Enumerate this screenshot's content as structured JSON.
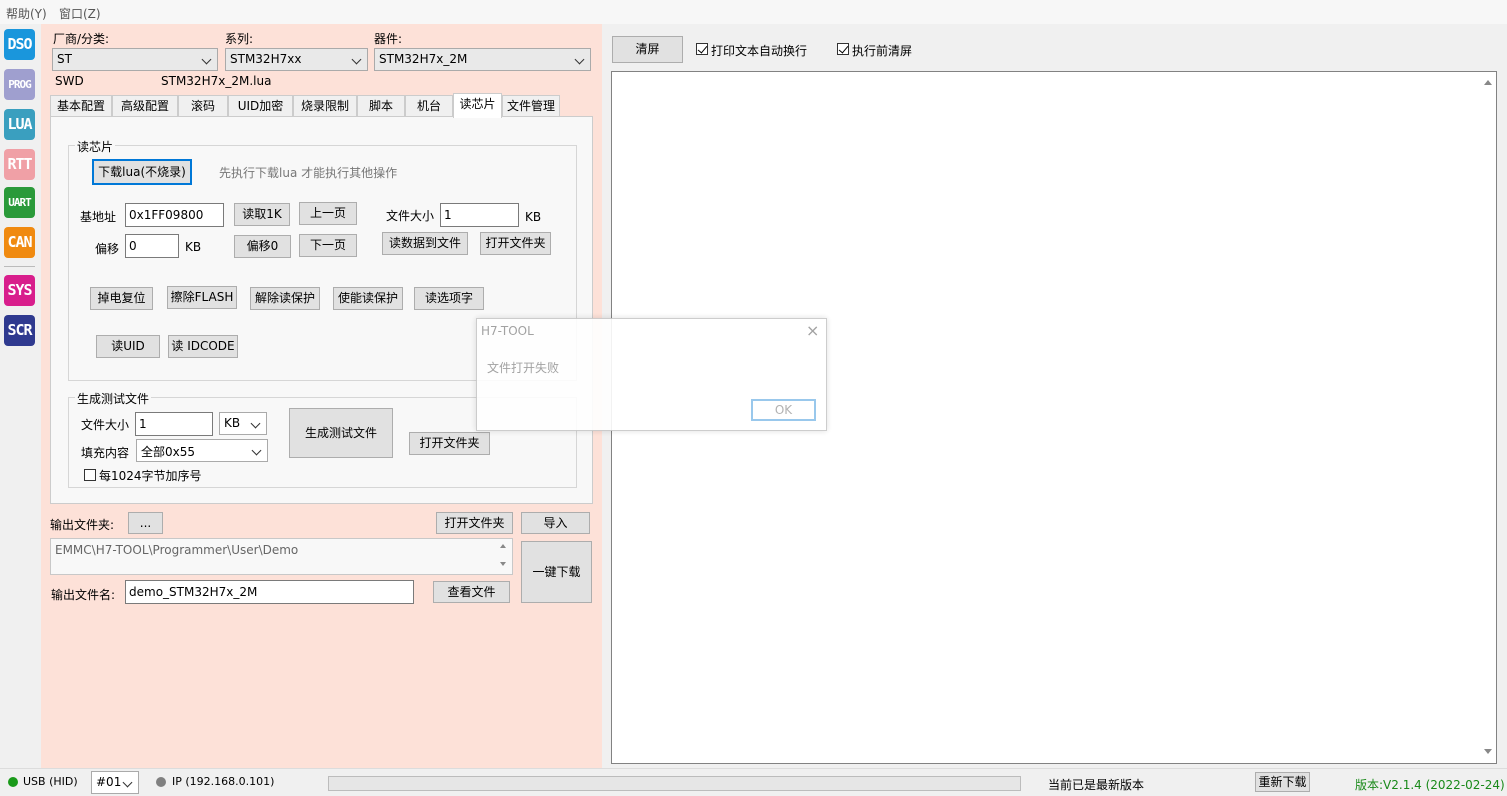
{
  "menu": {
    "help": "帮助(Y)",
    "window": "窗口(Z)"
  },
  "sidebar": {
    "items": [
      {
        "label": "DSO",
        "color": "#1a96dc"
      },
      {
        "label": "PROG",
        "color": "#9f9fcf"
      },
      {
        "label": "LUA",
        "color": "#3a9fbf"
      },
      {
        "label": "RTT",
        "color": "#f0a0a6"
      },
      {
        "label": "UART",
        "color": "#2a9a3a"
      },
      {
        "label": "CAN",
        "color": "#f08a10"
      },
      {
        "label": "SYS",
        "color": "#d81e8c"
      },
      {
        "label": "SCR",
        "color": "#2f3a8f"
      }
    ]
  },
  "device": {
    "vendor_label": "厂商/分类:",
    "vendor_value": "ST",
    "series_label": "系列:",
    "series_value": "STM32H7xx",
    "chip_label": "器件:",
    "chip_value": "STM32H7x_2M",
    "interface": "SWD",
    "lua_file": "STM32H7x_2M.lua"
  },
  "tabs": [
    {
      "label": "基本配置"
    },
    {
      "label": "高级配置"
    },
    {
      "label": "滚码"
    },
    {
      "label": "UID加密"
    },
    {
      "label": "烧录限制"
    },
    {
      "label": "脚本"
    },
    {
      "label": "机台"
    },
    {
      "label": "读芯片"
    },
    {
      "label": "文件管理"
    }
  ],
  "read_chip": {
    "group_title": "读芯片",
    "download_lua_button": "下载lua(不烧录)",
    "hint": "先执行下载lua 才能执行其他操作",
    "base_addr_label": "基地址",
    "base_addr_value": "0x1FF09800",
    "read1k_button": "读取1K",
    "prev_page_button": "上一页",
    "file_size_label": "文件大小",
    "file_size_value": "1",
    "kb_unit": "KB",
    "offset_label": "偏移",
    "offset_value": "0",
    "offset_unit": "KB",
    "offset0_button": "偏移0",
    "next_page_button": "下一页",
    "read_to_file_button": "读数据到文件",
    "open_folder_button": "打开文件夹",
    "power_reset_button": "掉电复位",
    "erase_flash_button": "擦除FLASH",
    "unprotect_button": "解除读保护",
    "protect_button": "使能读保护",
    "read_option_button": "读选项字",
    "read_uid_button": "读UID",
    "read_idcode_button": "读 IDCODE"
  },
  "gen_test": {
    "group_title": "生成测试文件",
    "file_size_label": "文件大小",
    "file_size_value": "1",
    "unit_value": "KB",
    "fill_label": "填充内容",
    "fill_value": "全部0x55",
    "seq_checkbox_label": "每1024字节加序号",
    "generate_button": "生成测试文件",
    "open_folder_button": "打开文件夹"
  },
  "output": {
    "folder_label": "输出文件夹:",
    "browse_button": "...",
    "open_folder_button": "打开文件夹",
    "import_button": "导入",
    "path_value": "EMMC\\H7-TOOL\\Programmer\\User\\Demo",
    "one_click_button": "一键下载",
    "filename_label": "输出文件名:",
    "filename_value": "demo_STM32H7x_2M",
    "view_file_button": "查看文件"
  },
  "log": {
    "clear_button": "清屏",
    "wrap_label": "打印文本自动换行",
    "clear_before_label": "执行前清屏"
  },
  "dialog": {
    "title": "H7-TOOL",
    "message": "文件打开失败",
    "ok_button": "OK"
  },
  "status": {
    "usb_label": "USB (HID)",
    "device_no": "#01",
    "ip_label": "IP (192.168.0.101)",
    "version_status": "当前已是最新版本",
    "redownload_button": "重新下载",
    "version": "版本:V2.1.4 (2022-02-24)",
    "usb_color": "#1a9a1a",
    "ip_color": "#808080",
    "version_color": "#1a8a1a"
  }
}
